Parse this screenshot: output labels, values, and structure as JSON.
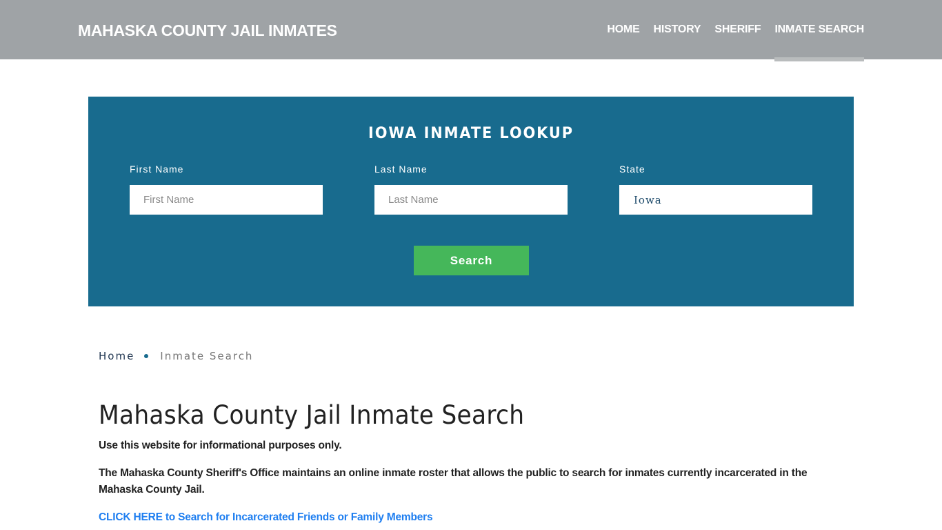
{
  "header": {
    "brand": "MAHASKA COUNTY JAIL INMATES",
    "nav": [
      {
        "label": "HOME",
        "active": false
      },
      {
        "label": "HISTORY",
        "active": false
      },
      {
        "label": "SHERIFF",
        "active": false
      },
      {
        "label": "INMATE SEARCH",
        "active": true
      }
    ]
  },
  "lookup": {
    "title": "IOWA INMATE LOOKUP",
    "first_name": {
      "label": "First Name",
      "placeholder": "First Name",
      "value": ""
    },
    "last_name": {
      "label": "Last Name",
      "placeholder": "Last Name",
      "value": ""
    },
    "state": {
      "label": "State",
      "value": "Iowa"
    },
    "search_label": "Search"
  },
  "breadcrumb": {
    "home": "Home",
    "current": "Inmate Search"
  },
  "content": {
    "title": "Mahaska County Jail Inmate Search",
    "disclaimer": "Use this website for informational purposes only.",
    "description": "The Mahaska County Sheriff's Office maintains an online inmate roster that allows the public to search for inmates currently incarcerated in the Mahaska County Jail.",
    "cta": "CLICK HERE to Search for Incarcerated Friends or Family Members"
  },
  "colors": {
    "header_bg": "#9fa3a6",
    "panel_bg": "#186b8e",
    "button_bg": "#45b75a",
    "link": "#1e7ef0"
  }
}
